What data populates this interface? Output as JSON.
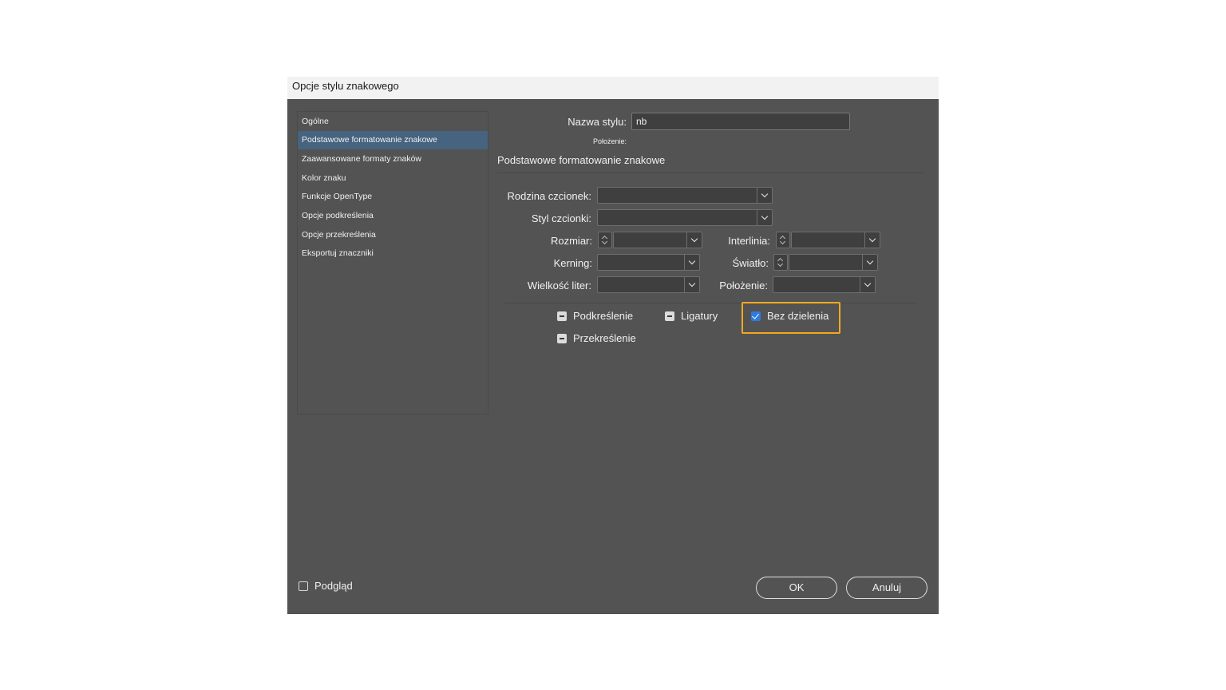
{
  "window": {
    "title": "Opcje stylu znakowego"
  },
  "sidebar": {
    "items": [
      {
        "label": "Ogólne"
      },
      {
        "label": "Podstawowe formatowanie znakowe",
        "selected": true
      },
      {
        "label": "Zaawansowane formaty znaków"
      },
      {
        "label": "Kolor znaku"
      },
      {
        "label": "Funkcje OpenType"
      },
      {
        "label": "Opcje podkreślenia"
      },
      {
        "label": "Opcje przekreślenia"
      },
      {
        "label": "Eksportuj znaczniki"
      }
    ]
  },
  "form": {
    "style_name_label": "Nazwa stylu:",
    "style_name_value": "nb",
    "position_caption": "Położenie:",
    "section_title": "Podstawowe formatowanie znakowe",
    "font_family_label": "Rodzina czcionek:",
    "font_style_label": "Styl czcionki:",
    "size_label": "Rozmiar:",
    "leading_label": "Interlinia:",
    "kerning_label": "Kerning:",
    "tracking_label": "Światło:",
    "case_label": "Wielkość liter:",
    "position_label": "Położenie:"
  },
  "checkboxes": {
    "underline": {
      "label": "Podkreślenie",
      "state": "mixed"
    },
    "ligatures": {
      "label": "Ligatury",
      "state": "mixed"
    },
    "no_break": {
      "label": "Bez dzielenia",
      "state": "checked"
    },
    "strikethrough": {
      "label": "Przekreślenie",
      "state": "mixed"
    }
  },
  "footer": {
    "preview_label": "Podgląd",
    "ok_label": "OK",
    "cancel_label": "Anuluj"
  },
  "colors": {
    "dialog_bg": "#535353",
    "selection": "#46637f",
    "highlight": "#f2a91e",
    "checkbox_checked": "#2d7ae0"
  }
}
